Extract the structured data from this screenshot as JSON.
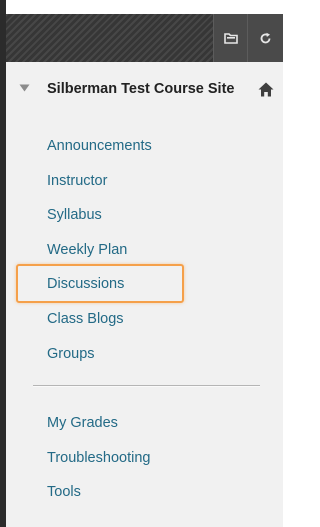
{
  "toolbar": {
    "folder_icon": "folder-icon",
    "refresh_icon": "refresh-icon"
  },
  "course": {
    "title": "Silberman Test Course Site",
    "collapse_icon": "triangle-down-icon",
    "home_icon": "home-icon"
  },
  "menu": {
    "items": [
      {
        "label": "Announcements"
      },
      {
        "label": "Instructor"
      },
      {
        "label": "Syllabus"
      },
      {
        "label": "Weekly Plan"
      },
      {
        "label": "Discussions",
        "highlighted": true
      },
      {
        "label": "Class Blogs"
      },
      {
        "label": "Groups"
      }
    ],
    "tools": [
      {
        "label": "My Grades"
      },
      {
        "label": "Troubleshooting"
      },
      {
        "label": "Tools"
      }
    ]
  },
  "colors": {
    "link": "#236a86",
    "highlight": "#f5a04a",
    "panel": "#f1f1f1",
    "toolbar": "#3a3a3a"
  }
}
